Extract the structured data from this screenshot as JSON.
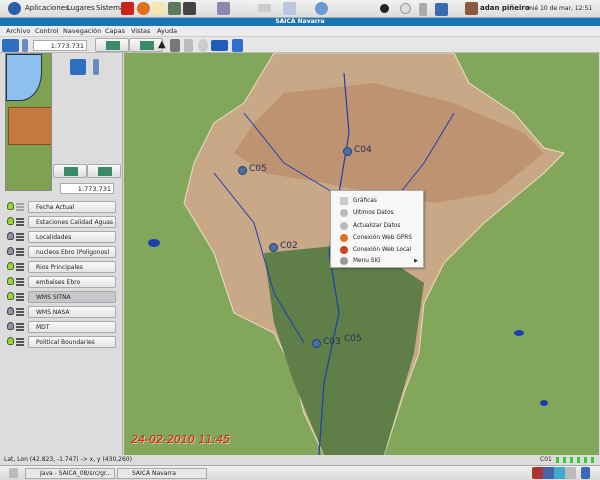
{
  "top_panel": {
    "menus": [
      "Aplicaciones",
      "Lugares",
      "Sistema"
    ],
    "user": "adan piñeiro",
    "datetime": "mié 10 de mar, 12:51"
  },
  "window": {
    "title": "SAICA Navarra"
  },
  "menubar": [
    "Archivo",
    "Control",
    "Navegación",
    "Capas",
    "Vistas",
    "Ayuda"
  ],
  "toolbar": {
    "scale": "1:773.731"
  },
  "overview": {
    "scale": "1:773.731"
  },
  "layers": [
    {
      "label": "Fecha Actual",
      "visible": true
    },
    {
      "label": "Estaciones Calidad Aguas",
      "visible": true
    },
    {
      "label": "Localidades",
      "visible": false
    },
    {
      "label": "nucleos Ebro (Poligonos)",
      "visible": false
    },
    {
      "label": "Rios Principales",
      "visible": true
    },
    {
      "label": "embalses Ebro",
      "visible": true
    },
    {
      "label": "WMS SITNA",
      "visible": true,
      "selected": true
    },
    {
      "label": "WMS NASA",
      "visible": false
    },
    {
      "label": "MDT",
      "visible": false
    },
    {
      "label": "Political Boundaries",
      "visible": true
    }
  ],
  "map": {
    "stations": [
      "C05",
      "C04",
      "C02",
      "C03",
      "C05"
    ],
    "date_label": "24-02-2010 11:45"
  },
  "context_menu": [
    "Gráficas",
    "Ultimos Datos",
    "Actualizar Datos",
    "Conexión Web GPRS",
    "Conexión Web Local",
    "Menu SIG"
  ],
  "status": {
    "coords": "Lat, Lon (42.823, -1.747) -> x, y (430,260)",
    "station": "C01"
  },
  "taskbar": [
    "Java - SAICA_08/src/gr...",
    "SAICA Navarra"
  ]
}
